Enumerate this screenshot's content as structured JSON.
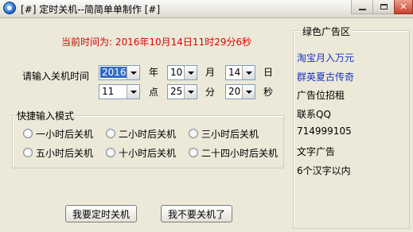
{
  "window": {
    "title": "[#] 定时关机--简简单单制作 [#]",
    "close_glyph": "✕"
  },
  "current_time": "当前时间为: 2016年10月14日11时29分6秒",
  "shutdown_time": {
    "label": "请输入关机时间",
    "year": {
      "value": "2016",
      "unit": "年"
    },
    "month": {
      "value": "10",
      "unit": "月"
    },
    "day": {
      "value": "14",
      "unit": "日"
    },
    "hour": {
      "value": "11",
      "unit": "点"
    },
    "minute": {
      "value": "25",
      "unit": "分"
    },
    "second": {
      "value": "20",
      "unit": "秒"
    }
  },
  "quick_mode": {
    "label": "快捷输入模式",
    "options": [
      "一小时后关机",
      "二小时后关机",
      "三小时后关机",
      "五小时后关机",
      "十小时后关机",
      "二十四小时后关机"
    ]
  },
  "ad_panel": {
    "title": "绿色广告区",
    "lines": [
      "淘宝月入万元",
      "群英夏古传奇",
      "广告位招租",
      "联系QQ",
      "714999105",
      "文字广告",
      "6个汉字以内"
    ]
  },
  "buttons": {
    "set_shutdown": "我要定时关机",
    "cancel_shutdown": "我不要关机了"
  }
}
